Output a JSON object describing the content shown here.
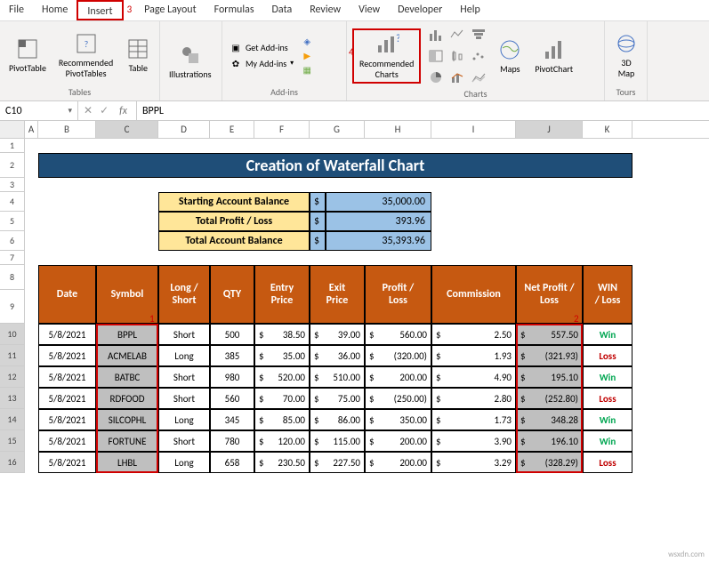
{
  "ribbon": {
    "tabs": [
      "File",
      "Home",
      "Insert",
      "Page Layout",
      "Formulas",
      "Data",
      "Review",
      "View",
      "Developer",
      "Help"
    ],
    "steps": {
      "insert": "3",
      "rec_charts": "4"
    },
    "tables": {
      "pivot": "PivotTable",
      "rec_pivot": "Recommended\nPivotTables",
      "table": "Table",
      "group": "Tables"
    },
    "illustrations": {
      "btn": "Illustrations",
      "group": ""
    },
    "addins": {
      "get": "Get Add-ins",
      "my": "My Add-ins",
      "group": "Add-ins"
    },
    "charts": {
      "recommended": "Recommended\nCharts",
      "maps": "Maps",
      "pivotchart": "PivotChart",
      "group": "Charts"
    },
    "tours": {
      "map": "3D\nMap",
      "group": "Tours"
    }
  },
  "namebox": "C10",
  "formula_value": "BPPL",
  "columns": [
    "A",
    "B",
    "C",
    "D",
    "E",
    "F",
    "G",
    "H",
    "I",
    "J",
    "K"
  ],
  "title": "Creation of Waterfall Chart",
  "summary": [
    {
      "label": "Starting Account Balance",
      "d": "$",
      "val": "35,000.00"
    },
    {
      "label": "Total Profit / Loss",
      "d": "$",
      "val": "393.96"
    },
    {
      "label": "Total Account Balance",
      "d": "$",
      "val": "35,393.96"
    }
  ],
  "headers": [
    "Date",
    "Symbol",
    "Long / Short",
    "QTY",
    "Entry Price",
    "Exit Price",
    "Profit / Loss",
    "Commission",
    "Net Profit / Loss",
    "WIN / Loss"
  ],
  "rows": [
    {
      "date": "5/8/2021",
      "sym": "BPPL",
      "ls": "Short",
      "qty": "500",
      "entry": "38.50",
      "exit": "39.00",
      "pl": "560.00",
      "plneg": false,
      "comm": "2.50",
      "net": "557.50",
      "netneg": false,
      "wl": "Win"
    },
    {
      "date": "5/8/2021",
      "sym": "ACMELAB",
      "ls": "Long",
      "qty": "385",
      "entry": "35.00",
      "exit": "36.00",
      "pl": "(320.00)",
      "plneg": true,
      "comm": "1.93",
      "net": "(321.93)",
      "netneg": true,
      "wl": "Loss"
    },
    {
      "date": "5/8/2021",
      "sym": "BATBC",
      "ls": "Short",
      "qty": "980",
      "entry": "520.00",
      "exit": "510.00",
      "pl": "200.00",
      "plneg": false,
      "comm": "4.90",
      "net": "195.10",
      "netneg": false,
      "wl": "Win"
    },
    {
      "date": "5/8/2021",
      "sym": "RDFOOD",
      "ls": "Short",
      "qty": "560",
      "entry": "70.00",
      "exit": "75.00",
      "pl": "(250.00)",
      "plneg": true,
      "comm": "2.80",
      "net": "(252.80)",
      "netneg": true,
      "wl": "Loss"
    },
    {
      "date": "5/8/2021",
      "sym": "SILCOPHL",
      "ls": "Long",
      "qty": "345",
      "entry": "85.00",
      "exit": "86.00",
      "pl": "350.00",
      "plneg": false,
      "comm": "1.73",
      "net": "348.28",
      "netneg": false,
      "wl": "Win"
    },
    {
      "date": "5/8/2021",
      "sym": "FORTUNE",
      "ls": "Short",
      "qty": "780",
      "entry": "120.00",
      "exit": "115.00",
      "pl": "200.00",
      "plneg": false,
      "comm": "3.90",
      "net": "196.10",
      "netneg": false,
      "wl": "Win"
    },
    {
      "date": "5/8/2021",
      "sym": "LHBL",
      "ls": "Long",
      "qty": "658",
      "entry": "230.50",
      "exit": "227.50",
      "pl": "200.00",
      "plneg": false,
      "comm": "3.29",
      "net": "(328.29)",
      "netneg": true,
      "wl": "Loss"
    }
  ],
  "row_nums": [
    "1",
    "2",
    "3",
    "4",
    "5",
    "6",
    "7",
    "8",
    "9",
    "10",
    "11",
    "12",
    "13",
    "14",
    "15",
    "16"
  ],
  "steps_small": {
    "col_c": "1",
    "col_j": "2"
  },
  "watermark": "wsxdn.com"
}
